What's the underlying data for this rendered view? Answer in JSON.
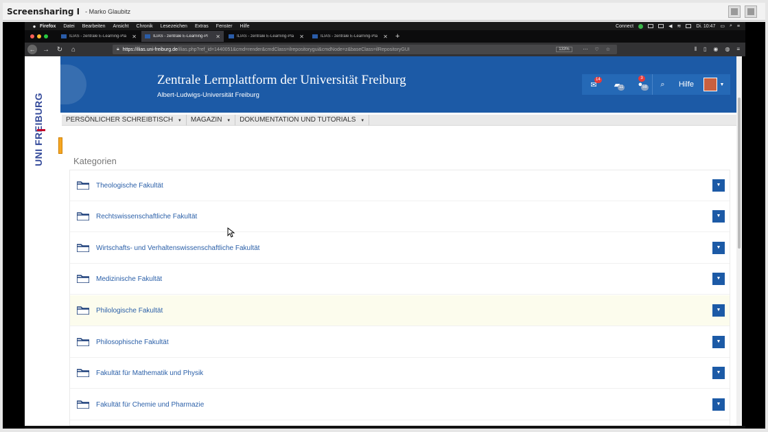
{
  "window": {
    "title": "Screensharing I",
    "presenter": "- Marko Glaubitz"
  },
  "mac_menubar": {
    "app": "Firefox",
    "items": [
      "Datei",
      "Bearbeiten",
      "Ansicht",
      "Chronik",
      "Lesezeichen",
      "Extras",
      "Fenster",
      "Hilfe"
    ],
    "status": {
      "connect": "Connect",
      "clock": "Di. 10:47"
    }
  },
  "browser": {
    "tabs": [
      {
        "title": "ILIAS - zentrale E-Learning-Pla",
        "active": false
      },
      {
        "title": "ILIAS - zentrale E-Learning-Pl",
        "active": true
      },
      {
        "title": "ILIAS - zentrale E-Learning-Pla",
        "active": false
      },
      {
        "title": "ILIAS - zentrale E-Learning-Pla",
        "active": false
      }
    ],
    "url_host": "https://ilias.uni-freiburg.de",
    "url_path": "/ilias.php?ref_id=1440051&cmd=render&cmdClass=ilrepositorygui&cmdNode=z&baseClass=ilRepositoryGUI",
    "zoom": "133%"
  },
  "site": {
    "logo_text": "UNI FREIBURG",
    "title": "Zentrale Lernplattform der Universität Freiburg",
    "subtitle": "Albert-Ludwigs-Universität Freiburg",
    "mail_count": "14",
    "chat_count": "11",
    "contacts_count": "3",
    "contacts_sub": "58",
    "help_label": "Hilfe"
  },
  "main_menu": [
    "PERSÖNLICHER SCHREIBTISCH",
    "MAGAZIN",
    "DOKUMENTATION UND TUTORIALS"
  ],
  "categories_title": "Kategorien",
  "categories": [
    {
      "label": "Theologische Fakultät"
    },
    {
      "label": "Rechtswissenschaftliche Fakultät"
    },
    {
      "label": "Wirtschafts- und Verhaltenswissenschaftliche Fakultät"
    },
    {
      "label": "Medizinische Fakultät"
    },
    {
      "label": "Philologische Fakultät",
      "highlighted": true
    },
    {
      "label": "Philosophische Fakultät"
    },
    {
      "label": "Fakultät für Mathematik und Physik"
    },
    {
      "label": "Fakultät für Chemie und Pharmazie"
    }
  ],
  "colors": {
    "brand_blue": "#1c5aa6",
    "link_blue": "#2a5fa8",
    "badge_red": "#e53b3b"
  }
}
